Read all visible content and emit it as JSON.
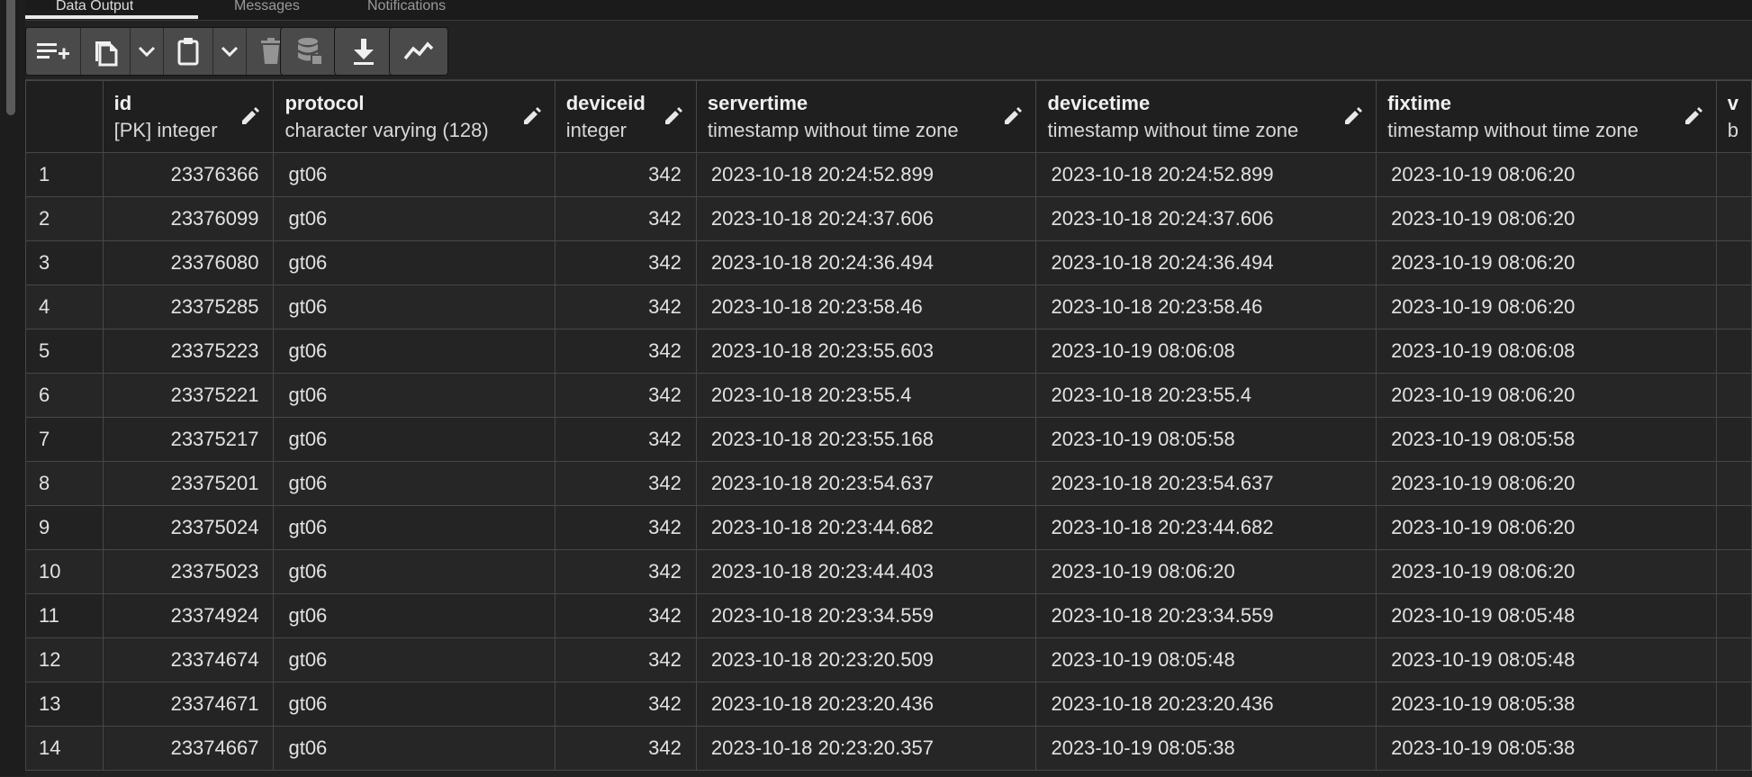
{
  "tabs": [
    {
      "label": "Data Output"
    },
    {
      "label": "Messages"
    },
    {
      "label": "Notifications"
    }
  ],
  "toolbar": {
    "buttons": [
      {
        "icon": "add-row-icon"
      },
      {
        "icon": "copy-icon"
      },
      {
        "icon": "chevron-down-icon"
      },
      {
        "icon": "paste-icon"
      },
      {
        "icon": "chevron-down-icon"
      },
      {
        "icon": "delete-icon"
      },
      {
        "icon": "save-data-icon"
      },
      {
        "icon": "download-icon"
      },
      {
        "icon": "graph-visualiser-icon"
      }
    ]
  },
  "columns": [
    {
      "name": "id",
      "type": "[PK] integer"
    },
    {
      "name": "protocol",
      "type": "character varying (128)"
    },
    {
      "name": "deviceid",
      "type": "integer"
    },
    {
      "name": "servertime",
      "type": "timestamp without time zone"
    },
    {
      "name": "devicetime",
      "type": "timestamp without time zone"
    },
    {
      "name": "fixtime",
      "type": "timestamp without time zone"
    },
    {
      "name": "v",
      "type": "b"
    }
  ],
  "rows": [
    {
      "n": "1",
      "id": "23376366",
      "protocol": "gt06",
      "deviceid": "342",
      "servertime": "2023-10-18 20:24:52.899",
      "devicetime": "2023-10-18 20:24:52.899",
      "fixtime": "2023-10-19 08:06:20"
    },
    {
      "n": "2",
      "id": "23376099",
      "protocol": "gt06",
      "deviceid": "342",
      "servertime": "2023-10-18 20:24:37.606",
      "devicetime": "2023-10-18 20:24:37.606",
      "fixtime": "2023-10-19 08:06:20"
    },
    {
      "n": "3",
      "id": "23376080",
      "protocol": "gt06",
      "deviceid": "342",
      "servertime": "2023-10-18 20:24:36.494",
      "devicetime": "2023-10-18 20:24:36.494",
      "fixtime": "2023-10-19 08:06:20"
    },
    {
      "n": "4",
      "id": "23375285",
      "protocol": "gt06",
      "deviceid": "342",
      "servertime": "2023-10-18 20:23:58.46",
      "devicetime": "2023-10-18 20:23:58.46",
      "fixtime": "2023-10-19 08:06:20"
    },
    {
      "n": "5",
      "id": "23375223",
      "protocol": "gt06",
      "deviceid": "342",
      "servertime": "2023-10-18 20:23:55.603",
      "devicetime": "2023-10-19 08:06:08",
      "fixtime": "2023-10-19 08:06:08"
    },
    {
      "n": "6",
      "id": "23375221",
      "protocol": "gt06",
      "deviceid": "342",
      "servertime": "2023-10-18 20:23:55.4",
      "devicetime": "2023-10-18 20:23:55.4",
      "fixtime": "2023-10-19 08:06:20"
    },
    {
      "n": "7",
      "id": "23375217",
      "protocol": "gt06",
      "deviceid": "342",
      "servertime": "2023-10-18 20:23:55.168",
      "devicetime": "2023-10-19 08:05:58",
      "fixtime": "2023-10-19 08:05:58"
    },
    {
      "n": "8",
      "id": "23375201",
      "protocol": "gt06",
      "deviceid": "342",
      "servertime": "2023-10-18 20:23:54.637",
      "devicetime": "2023-10-18 20:23:54.637",
      "fixtime": "2023-10-19 08:06:20"
    },
    {
      "n": "9",
      "id": "23375024",
      "protocol": "gt06",
      "deviceid": "342",
      "servertime": "2023-10-18 20:23:44.682",
      "devicetime": "2023-10-18 20:23:44.682",
      "fixtime": "2023-10-19 08:06:20"
    },
    {
      "n": "10",
      "id": "23375023",
      "protocol": "gt06",
      "deviceid": "342",
      "servertime": "2023-10-18 20:23:44.403",
      "devicetime": "2023-10-19 08:06:20",
      "fixtime": "2023-10-19 08:06:20"
    },
    {
      "n": "11",
      "id": "23374924",
      "protocol": "gt06",
      "deviceid": "342",
      "servertime": "2023-10-18 20:23:34.559",
      "devicetime": "2023-10-18 20:23:34.559",
      "fixtime": "2023-10-19 08:05:48"
    },
    {
      "n": "12",
      "id": "23374674",
      "protocol": "gt06",
      "deviceid": "342",
      "servertime": "2023-10-18 20:23:20.509",
      "devicetime": "2023-10-19 08:05:48",
      "fixtime": "2023-10-19 08:05:48"
    },
    {
      "n": "13",
      "id": "23374671",
      "protocol": "gt06",
      "deviceid": "342",
      "servertime": "2023-10-18 20:23:20.436",
      "devicetime": "2023-10-18 20:23:20.436",
      "fixtime": "2023-10-19 08:05:38"
    },
    {
      "n": "14",
      "id": "23374667",
      "protocol": "gt06",
      "deviceid": "342",
      "servertime": "2023-10-18 20:23:20.357",
      "devicetime": "2023-10-19 08:05:38",
      "fixtime": "2023-10-19 08:05:38"
    }
  ]
}
